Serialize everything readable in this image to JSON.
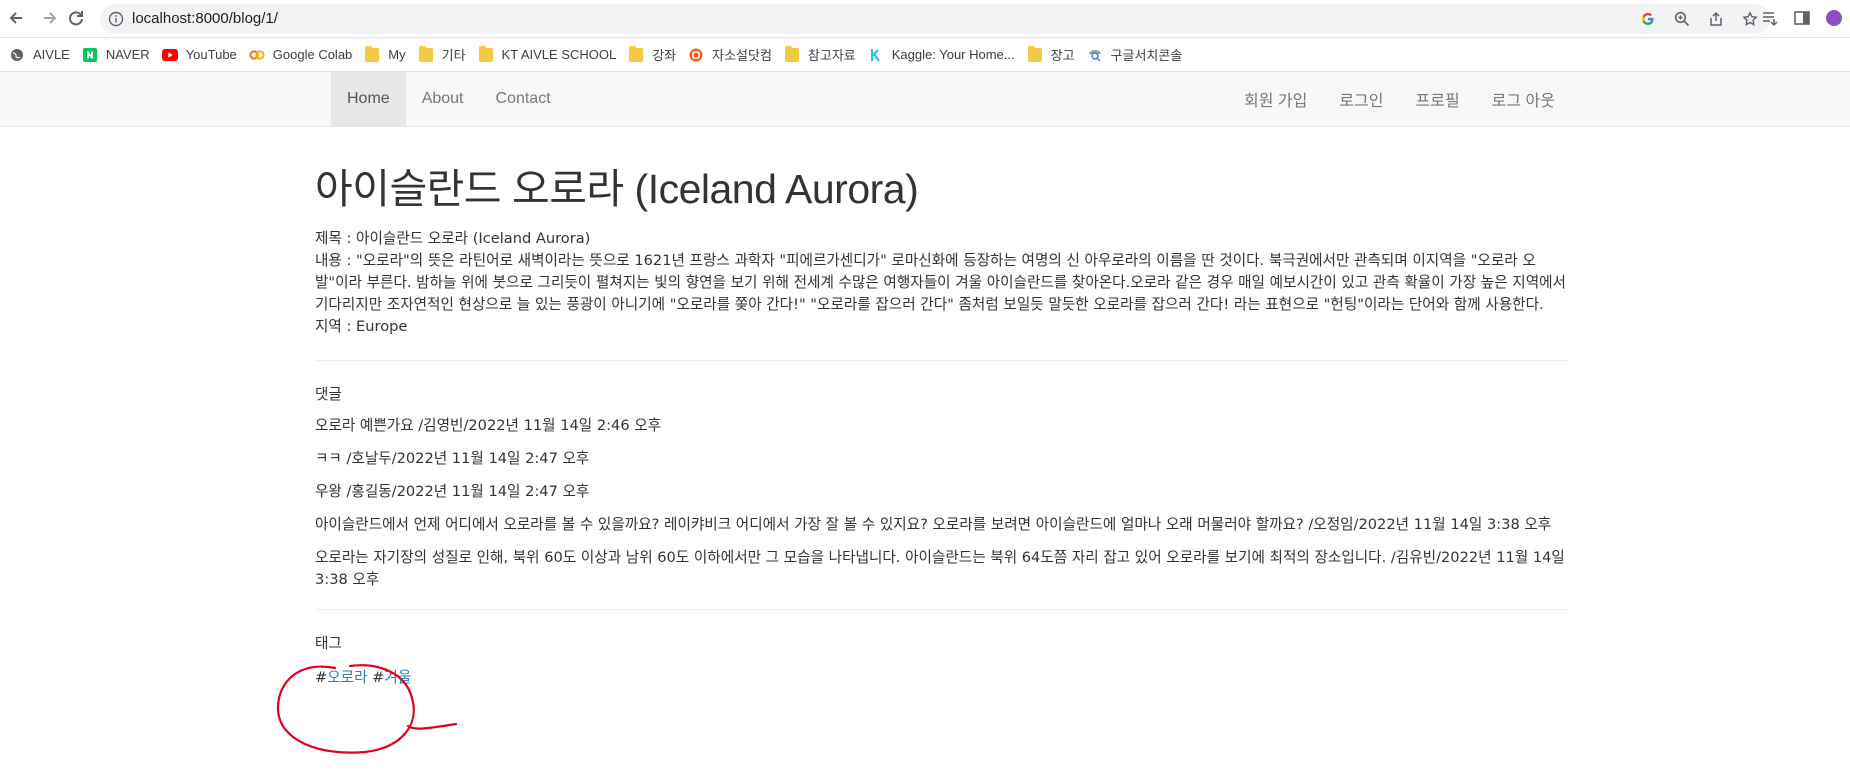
{
  "browser": {
    "url": "localhost:8000/blog/1/",
    "bookmarks": [
      {
        "label": "AIVLE",
        "icon": "globe-icon"
      },
      {
        "label": "NAVER",
        "icon": "naver-icon"
      },
      {
        "label": "YouTube",
        "icon": "youtube-icon"
      },
      {
        "label": "Google Colab",
        "icon": "colab-icon"
      },
      {
        "label": "My",
        "icon": "folder-icon"
      },
      {
        "label": "기타",
        "icon": "folder-icon"
      },
      {
        "label": "KT AIVLE SCHOOL",
        "icon": "folder-icon"
      },
      {
        "label": "강좌",
        "icon": "folder-icon"
      },
      {
        "label": "자소설닷컴",
        "icon": "jasoseol-icon"
      },
      {
        "label": "참고자료",
        "icon": "folder-icon"
      },
      {
        "label": "Kaggle: Your Home...",
        "icon": "kaggle-icon"
      },
      {
        "label": "장고",
        "icon": "folder-icon"
      },
      {
        "label": "구글서치콘솔",
        "icon": "search-console-icon"
      }
    ]
  },
  "navbar": {
    "left": [
      {
        "label": "Home",
        "active": true
      },
      {
        "label": "About",
        "active": false
      },
      {
        "label": "Contact",
        "active": false
      }
    ],
    "right": [
      {
        "label": "회원 가입"
      },
      {
        "label": "로그인"
      },
      {
        "label": "프로필"
      },
      {
        "label": "로그 아웃"
      }
    ]
  },
  "post": {
    "title": "아이슬란드 오로라 (Iceland Aurora)",
    "meta_title": "제목 : 아이슬란드 오로라 (Iceland Aurora)",
    "meta_body": "내용 : \"오로라\"의 뜻은 라틴어로 새벽이라는 뜻으로 1621년 프랑스 과학자 \"피에르가센디가\" 로마신화에 등장하는 여명의 신 아우로라의 이름을 딴 것이다. 북극권에서만 관측되며 이지역을 \"오로라 오발\"이라 부른다. 밤하늘 위에 붓으로 그리듯이 펼쳐지는 빛의 향연을 보기 위해 전세계 수많은 여행자들이 겨울 아이슬란드를 찾아온다.오로라 같은 경우 매일 예보시간이 있고 관측 확율이 가장 높은 지역에서 기다리지만 조자연적인 현상으로 늘 있는 풍광이 아니기에 \"오로라를 쫒아 간다!\" \"오로라를 잡으러 간다\" 좀처럼 보일듯 말듯한 오로라를 잡으러 간다! 라는 표현으로 \"헌팅\"이라는 단어와 함께 사용한다.",
    "meta_region": "지역 : Europe"
  },
  "comments": {
    "label": "댓글",
    "items": [
      "오로라 예쁜가요 /김영빈/2022년 11월 14일 2:46 오후",
      "ㅋㅋ /호날두/2022년 11월 14일 2:47 오후",
      "우왕 /홍길동/2022년 11월 14일 2:47 오후",
      "아이슬란드에서 언제 어디에서 오로라를 볼 수 있을까요? 레이캬비크 어디에서 가장 잘 볼 수 있지요? 오로라를 보려면 아이슬란드에 얼마나 오래 머물러야 할까요? /오정임/2022년 11월 14일 3:38 오후",
      "오로라는 자기장의 성질로 인해, 북위 60도 이상과 남위 60도 이하에서만 그 모습을 나타냅니다. 아이슬란드는 북위 64도쯤 자리 잡고 있어 오로라를 보기에 최적의 장소입니다. /김유빈/2022년 11월 14일 3:38 오후"
    ]
  },
  "tags": {
    "label": "태그",
    "items": [
      "오로라",
      "겨울"
    ],
    "prefix": "#"
  },
  "colors": {
    "link": "#337ab7",
    "annotation": "#e0001b",
    "navbar_bg": "#f8f8f8"
  }
}
